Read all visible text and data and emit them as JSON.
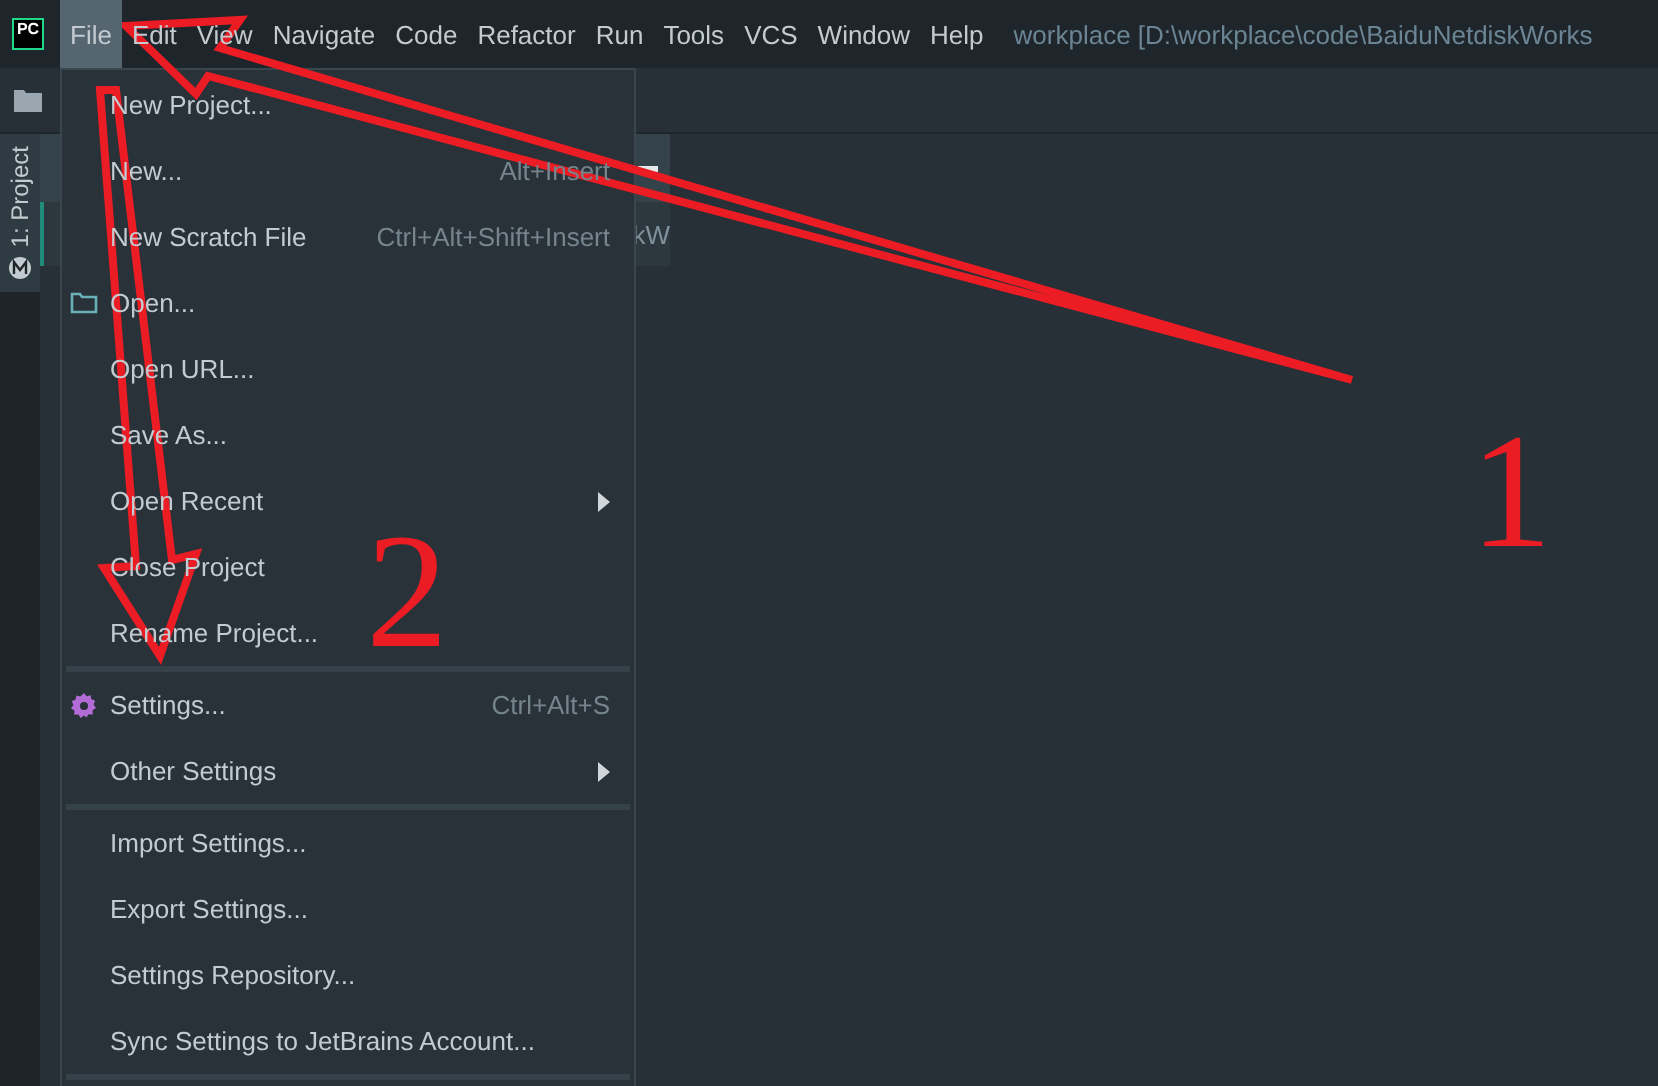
{
  "app_logo": {
    "text": "PC"
  },
  "menu_bar": [
    {
      "label": "File",
      "selected": true
    },
    {
      "label": "Edit",
      "selected": false
    },
    {
      "label": "View",
      "selected": false
    },
    {
      "label": "Navigate",
      "selected": false
    },
    {
      "label": "Code",
      "selected": false
    },
    {
      "label": "Refactor",
      "selected": false
    },
    {
      "label": "Run",
      "selected": false
    },
    {
      "label": "Tools",
      "selected": false
    },
    {
      "label": "VCS",
      "selected": false
    },
    {
      "label": "Window",
      "selected": false
    },
    {
      "label": "Help",
      "selected": false
    }
  ],
  "window_title": "workplace [D:\\workplace\\code\\BaiduNetdiskWorks",
  "side_tab": {
    "label": "1: Project"
  },
  "project_panel": {
    "row_text": "kW"
  },
  "file_menu": [
    {
      "kind": "plain",
      "label": "New Project..."
    },
    {
      "kind": "plain",
      "label": "New...",
      "shortcut": "Alt+Insert"
    },
    {
      "kind": "plain",
      "label": "New Scratch File",
      "shortcut": "Ctrl+Alt+Shift+Insert"
    },
    {
      "kind": "folder",
      "label": "Open..."
    },
    {
      "kind": "plain",
      "label": "Open URL..."
    },
    {
      "kind": "plain",
      "label": "Save As..."
    },
    {
      "kind": "submenu",
      "label": "Open Recent"
    },
    {
      "kind": "plain",
      "label": "Close Project"
    },
    {
      "kind": "plain",
      "label": "Rename Project..."
    },
    {
      "kind": "separator"
    },
    {
      "kind": "gear",
      "label": "Settings...",
      "shortcut": "Ctrl+Alt+S"
    },
    {
      "kind": "submenu",
      "label": "Other Settings"
    },
    {
      "kind": "separator"
    },
    {
      "kind": "plain",
      "label": "Import Settings..."
    },
    {
      "kind": "plain",
      "label": "Export Settings..."
    },
    {
      "kind": "plain",
      "label": "Settings Repository..."
    },
    {
      "kind": "plain",
      "label": "Sync Settings to JetBrains Account..."
    },
    {
      "kind": "separator"
    }
  ],
  "annotations": [
    {
      "text": "1"
    },
    {
      "text": "2"
    }
  ]
}
